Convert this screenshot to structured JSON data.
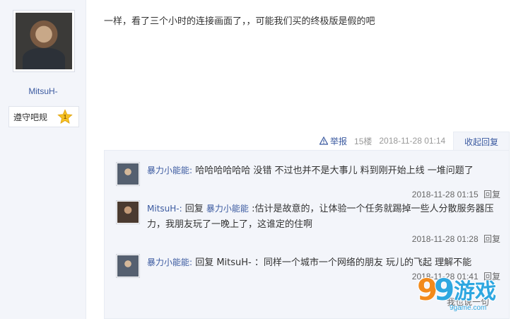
{
  "author": {
    "username": "MitsuH-",
    "badge_label": "遵守吧规",
    "badge_level": "1"
  },
  "post": {
    "text": "一样，看了三个小时的连接画面了，，可能我们买的终极版是假的吧"
  },
  "meta": {
    "report_label": "举报",
    "floor": "15楼",
    "timestamp": "2018-11-28 01:14",
    "fold_label": "收起回复"
  },
  "replies": [
    {
      "name": "暴力小能能",
      "name_suffix": ":",
      "text": " 哈哈哈哈哈哈 没错 不过也并不是大事儿 料到刚开始上线 一堆问题了",
      "time": "2018-11-28 01:15",
      "reply_label": "回复"
    },
    {
      "name": "MitsuH-",
      "name_suffix": ":",
      "prefix": " 回复 ",
      "reply_to": "暴力小能能",
      "text": " :估计是故意的，让体验一个任务就踢掉一些人分散服务器压力，我朋友玩了一晚上了，这谁定的住啊",
      "time": "2018-11-28 01:28",
      "reply_label": "回复"
    },
    {
      "name": "暴力小能能",
      "name_suffix": ":",
      "prefix": " 回复 ",
      "reply_to": "MitsuH-",
      "text": " ：同样一个城市一个网络的朋友 玩儿的飞起 理解不能",
      "time": "2018-11-28 01:41",
      "reply_label": "回复"
    }
  ],
  "footer_partial": "我也说一句",
  "watermark": {
    "text": "游戏",
    "number": "9",
    "domain": "9game.com"
  },
  "colors": {
    "link": "#3b5aa0",
    "sidebar_bg": "#f3f5fa",
    "watermark_orange": "#f28a1b",
    "watermark_blue": "#2ea7e0"
  }
}
